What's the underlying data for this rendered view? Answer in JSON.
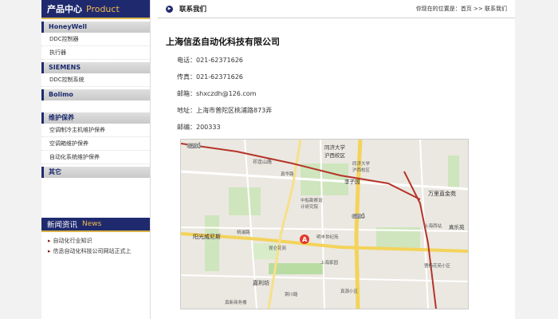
{
  "sidebar": {
    "header_cn": "产品中心",
    "header_en": "Product",
    "categories": [
      {
        "label": "HoneyWell",
        "items": [
          "DDC控制器",
          "执行器"
        ]
      },
      {
        "label": "SIEMENS",
        "items": [
          "DDC控制系统"
        ]
      },
      {
        "label": "Bolimo",
        "items": []
      },
      {
        "label": "维护保养",
        "items": [
          "空调制冷主机维护保养",
          "空调箱维护保养",
          "自动化系统维护保养"
        ]
      },
      {
        "label": "其它",
        "items": []
      }
    ],
    "news_cn": "新闻资讯",
    "news_en": "News",
    "news_items": [
      "自动化行业知识",
      "信丞自动化科技公司网站正式上"
    ]
  },
  "content": {
    "title": "联系我们",
    "breadcrumb_prefix": "你现在的位置是：",
    "breadcrumb_home": "首页",
    "breadcrumb_sep": " >> ",
    "breadcrumb_current": "联系我们",
    "company": "上海信丞自动化科技有限公司",
    "phone": "电话：021-62371626",
    "fax": "传真：021-62371626",
    "email": "邮箱：shxczdh@126.com",
    "address": "地址：上海市普陀区桃浦路873弄",
    "zip": "邮编：200333"
  },
  "map": {
    "labels": {
      "l1": "G204",
      "l2": "祁连山路",
      "l3": "同济大学",
      "l4": "沪西校区",
      "l5": "同济大学",
      "l6": "沪西校区",
      "l7": "李子园",
      "l8": "真华路",
      "l9": "中船勘察设",
      "l10": "计研究院",
      "l11": "万里直金苑",
      "l12": "G204",
      "l13": "阳光威尼斯",
      "l14": "桃浦路",
      "l15": "明丰世纪苑",
      "l16": "昆仑花苑",
      "l17": "上海西站",
      "l18": "真乐苑",
      "l19": "上海家园",
      "l20": "曹杨花苑小区",
      "l21": "嘉利坊",
      "l22": "铜川路",
      "l23": "真源小区",
      "l24": "真新商务楼",
      "marker": "A"
    },
    "colors": {
      "road_red": "#b5342a",
      "road_yellow": "#f3d35a",
      "green": "#b9dca3",
      "marker": "#e23b2e"
    }
  }
}
